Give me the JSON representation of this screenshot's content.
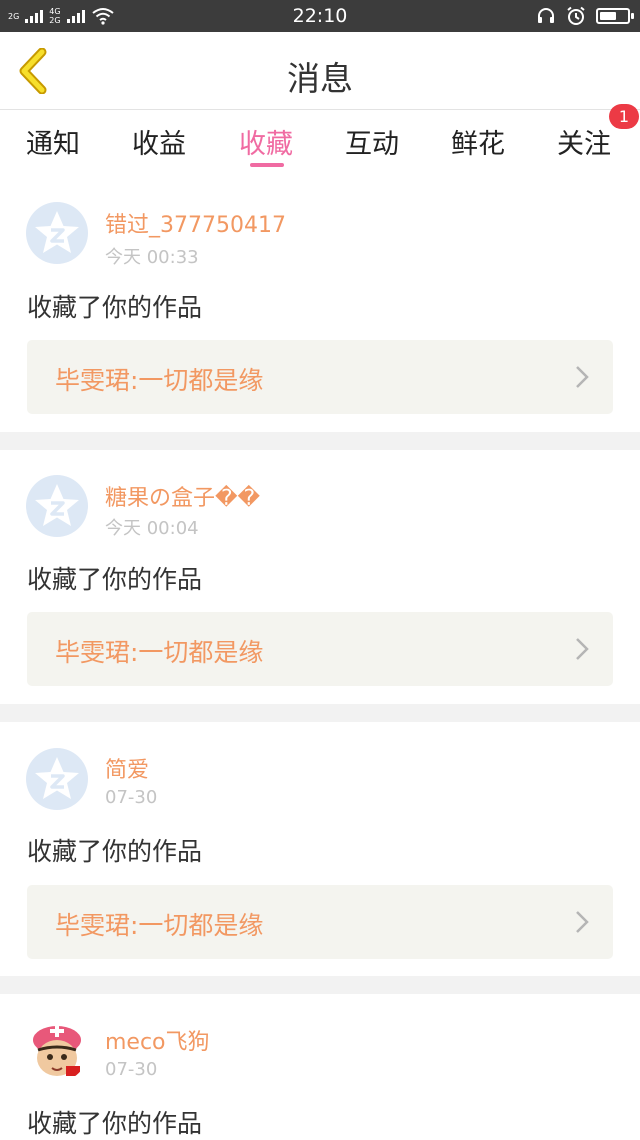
{
  "status_bar": {
    "time": "22:10",
    "sim1": "2G",
    "sim2_top": "4G",
    "sim2_bottom": "2G"
  },
  "header": {
    "title": "消息"
  },
  "tabs": [
    {
      "label": "通知"
    },
    {
      "label": "收益"
    },
    {
      "label": "收藏"
    },
    {
      "label": "互动"
    },
    {
      "label": "鲜花"
    },
    {
      "label": "关注"
    }
  ],
  "active_tab": "收藏",
  "follow_badge": "1",
  "notifications": [
    {
      "username": "错过_377750417",
      "time": "今天 00:33",
      "action": "收藏了你的作品",
      "work_title": "毕雯珺:一切都是缘"
    },
    {
      "username": "糖果の盒子��",
      "time": "今天 00:04",
      "action": "收藏了你的作品",
      "work_title": "毕雯珺:一切都是缘"
    },
    {
      "username": "简爱",
      "time": "07-30",
      "action": "收藏了你的作品",
      "work_title": "毕雯珺:一切都是缘"
    },
    {
      "username": "meco飞狗",
      "time": "07-30",
      "action": "收藏了你的作品",
      "work_title": ""
    }
  ],
  "colors": {
    "accent": "#f06ba2",
    "username": "#f29862",
    "badge": "#ec3a45",
    "status_bar": "#3c3c3c"
  },
  "icons": [
    "back-chevron-icon",
    "signal-icon",
    "wifi-icon",
    "headset-icon",
    "alarm-icon",
    "battery-icon",
    "default-avatar-icon",
    "chevron-right-icon"
  ]
}
